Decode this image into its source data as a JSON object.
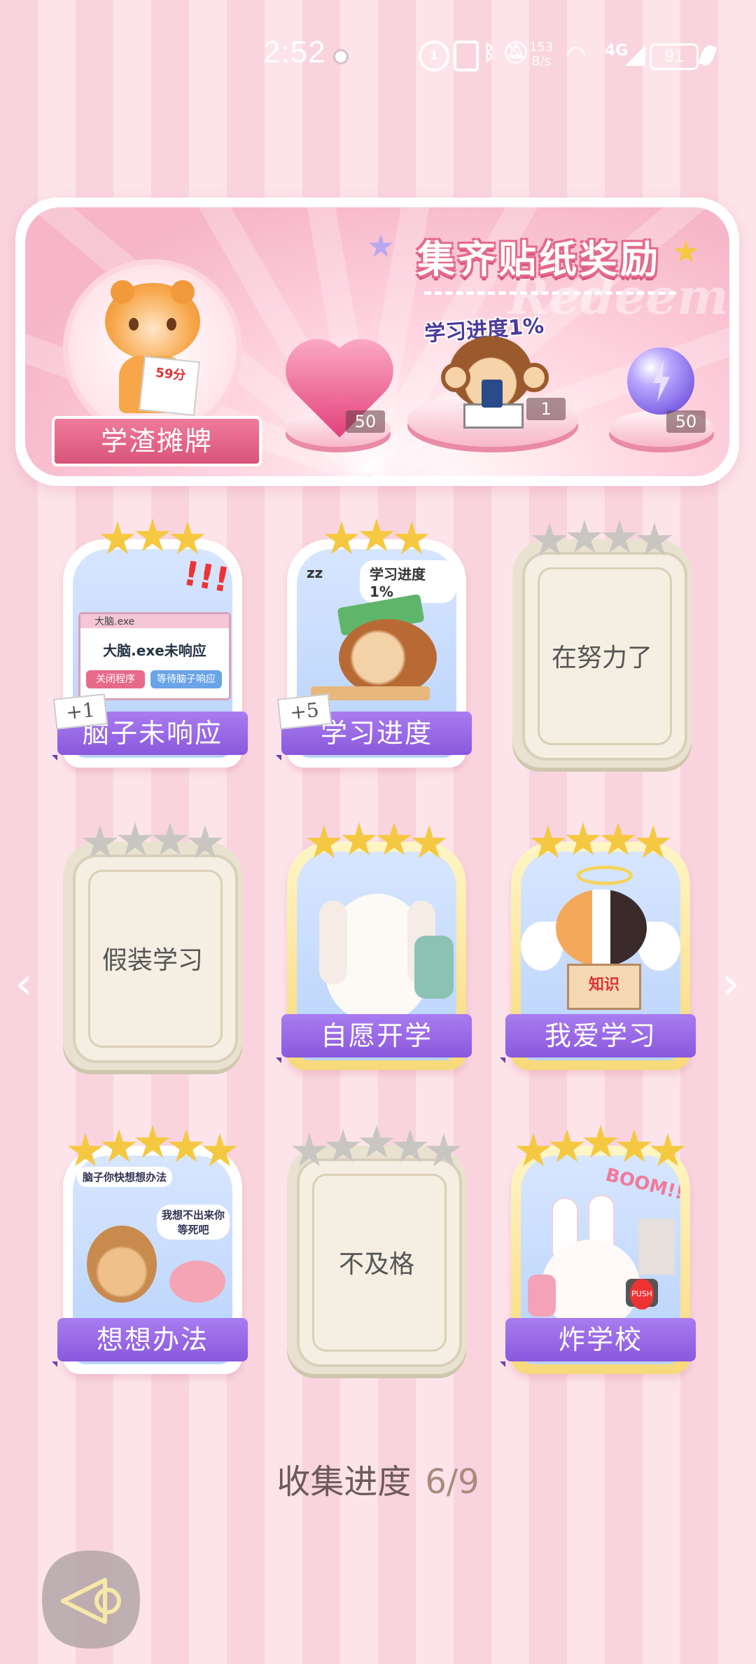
{
  "status_bar": {
    "time": "2:52",
    "net_speed_value": "153",
    "net_speed_unit": "B/s",
    "network": "4G",
    "battery": "91"
  },
  "banner": {
    "title": "集齐贴纸奖励",
    "avatar_badge": "学渣摊牌",
    "avatar_score": "59分",
    "center_caption": "学习进度1%",
    "rewards": [
      {
        "name": "heart-gem",
        "count": "50"
      },
      {
        "name": "monkey-sticker",
        "count": "1"
      },
      {
        "name": "lightning-orb",
        "count": "50"
      }
    ]
  },
  "stickers": [
    {
      "label": "脑子未响应",
      "stars": 3,
      "star_total": 3,
      "unlocked": true,
      "bonus": "+1",
      "art": {
        "window_title": "大脑.exe",
        "message": "大脑.exe未响应",
        "btn1": "关闭程序",
        "btn2": "等待脑子响应",
        "exclaim": "!!!"
      }
    },
    {
      "label": "学习进度",
      "stars": 3,
      "star_total": 3,
      "unlocked": true,
      "bonus": "+5",
      "art": {
        "caption": "学习进度1%",
        "zz": "zz"
      }
    },
    {
      "label": "在努力了",
      "stars": 0,
      "star_total": 4,
      "unlocked": false
    },
    {
      "label": "假装学习",
      "stars": 0,
      "star_total": 4,
      "unlocked": false
    },
    {
      "label": "自愿开学",
      "stars": 4,
      "star_total": 4,
      "unlocked": true
    },
    {
      "label": "我爱学习",
      "stars": 4,
      "star_total": 4,
      "unlocked": true,
      "art": {
        "book_text": "知识"
      }
    },
    {
      "label": "想想办法",
      "stars": 5,
      "star_total": 5,
      "unlocked": true,
      "art": {
        "bubble1": "脑子你快想想办法",
        "bubble2": "我想不出来你等死吧"
      }
    },
    {
      "label": "不及格",
      "stars": 0,
      "star_total": 5,
      "unlocked": false
    },
    {
      "label": "炸学校",
      "stars": 5,
      "star_total": 5,
      "unlocked": true,
      "art": {
        "boom": "BOOM!!",
        "push": "PUSH"
      }
    }
  ],
  "progress": {
    "label": "收集进度",
    "value": "6/9"
  },
  "colors": {
    "gold_star": "#f5c842",
    "grey_star": "#c9c6c2",
    "label_purple": "#9a68e4",
    "pink_accent": "#e46a8c"
  },
  "icons": {
    "prev": "chevron-left-icon",
    "next": "chevron-right-icon",
    "back": "back-arrow-icon"
  }
}
